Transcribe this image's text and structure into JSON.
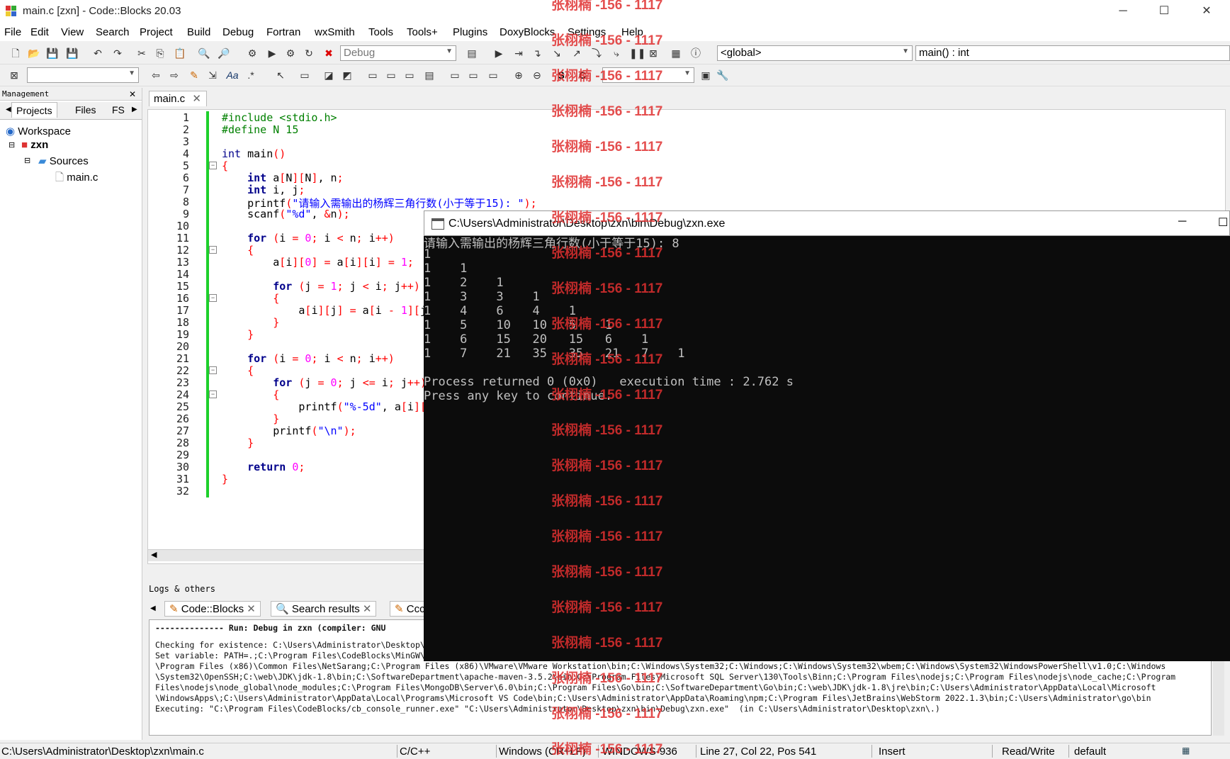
{
  "window": {
    "title": "main.c [zxn] - Code::Blocks 20.03",
    "minimize": "─",
    "maximize": "☐",
    "close": "✕"
  },
  "menu": [
    "File",
    "Edit",
    "View",
    "Search",
    "Project",
    "Build",
    "Debug",
    "Fortran",
    "wxSmith",
    "Tools",
    "Tools+",
    "Plugins",
    "DoxyBlocks",
    "Settings",
    "Help"
  ],
  "toolbar": {
    "build_target": "Debug",
    "scope": "<global>",
    "function": "main() : int"
  },
  "management": {
    "header": "Management",
    "tabs": [
      "Projects",
      "Files",
      "FS"
    ],
    "tree": {
      "workspace": "Workspace",
      "project": "zxn",
      "folder": "Sources",
      "file": "main.c"
    }
  },
  "editor": {
    "tab": "main.c",
    "line_numbers": [
      "1",
      "2",
      "3",
      "4",
      "5",
      "6",
      "7",
      "8",
      "9",
      "10",
      "11",
      "12",
      "13",
      "14",
      "15",
      "16",
      "17",
      "18",
      "19",
      "20",
      "21",
      "22",
      "23",
      "24",
      "25",
      "26",
      "27",
      "28",
      "29",
      "30",
      "31",
      "32"
    ]
  },
  "console": {
    "title": "C:\\Users\\Administrator\\Desktop\\zxn\\bin\\Debug\\zxn.exe",
    "lines": [
      "请输入需输出的杨辉三角行数(小于等于15): 8",
      "1",
      "1    1",
      "1    2    1",
      "1    3    3    1",
      "1    4    6    4    1",
      "1    5    10   10   5    1",
      "1    6    15   20   15   6    1",
      "1    7    21   35   35   21   7    1",
      "",
      "Process returned 0 (0x0)   execution time : 2.762 s",
      "Press any key to continue."
    ]
  },
  "logs": {
    "header": "Logs & others",
    "tabs": [
      "Code::Blocks",
      "Search results",
      "Ccc"
    ],
    "lines": [
      "-------------- Run: Debug in zxn (compiler: GNU",
      "",
      "Checking for existence: C:\\Users\\Administrator\\Desktop\\",
      "Set variable: PATH=.;C:\\Program Files\\CodeBlocks\\MinGW\\",
      "\\Program Files (x86)\\Common Files\\NetSarang;C:\\Program Files (x86)\\VMware\\VMware Workstation\\bin;C:\\Windows\\System32;C:\\Windows;C:\\Windows\\System32\\wbem;C:\\Windows\\System32\\WindowsPowerShell\\v1.0;C:\\Windows",
      "\\System32\\OpenSSH;C:\\web\\JDK\\jdk-1.8\\bin;C:\\SoftwareDepartment\\apache-maven-3.5.2\\bin;C:\\Program Files\\Microsoft SQL Server\\130\\Tools\\Binn;C:\\Program Files\\nodejs;C:\\Program Files\\nodejs\\node_cache;C:\\Program",
      "Files\\nodejs\\node_global\\node_modules;C:\\Program Files\\MongoDB\\Server\\6.0\\bin;C:\\Program Files\\Go\\bin;C:\\SoftwareDepartment\\Go\\bin;C:\\web\\JDK\\jdk-1.8\\jre\\bin;C:\\Users\\Administrator\\AppData\\Local\\Microsoft",
      "\\WindowsApps\\;C:\\Users\\Administrator\\AppData\\Local\\Programs\\Microsoft VS Code\\bin;C:\\Users\\Administrator\\AppData\\Roaming\\npm;C:\\Program Files\\JetBrains\\WebStorm 2022.1.3\\bin;C:\\Users\\Administrator\\go\\bin",
      "Executing: \"C:\\Program Files\\CodeBlocks/cb_console_runner.exe\" \"C:\\Users\\Administrator\\Desktop\\zxn\\bin\\Debug\\zxn.exe\"  (in C:\\Users\\Administrator\\Desktop\\zxn\\.)"
    ]
  },
  "status": {
    "path": "C:\\Users\\Administrator\\Desktop\\zxn\\main.c",
    "lang": "C/C++",
    "eol": "Windows (CR+LF)",
    "encoding": "WINDOWS-936",
    "position": "Line 27, Col 22, Pos 541",
    "mode": "Insert",
    "access": "Read/Write",
    "profile": "default"
  },
  "watermark": "张栩楠 -156 - 1117"
}
